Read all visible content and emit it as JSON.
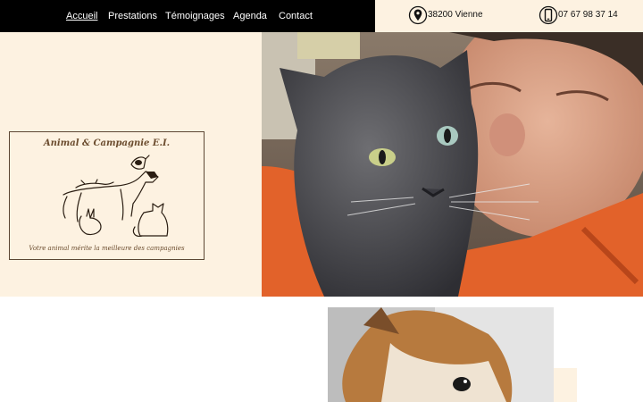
{
  "nav": {
    "items": [
      {
        "label": "Accueil",
        "active": true
      },
      {
        "label": "Prestations"
      },
      {
        "label": "Témoignages"
      },
      {
        "label": "Agenda"
      },
      {
        "label": "Contact"
      }
    ]
  },
  "contact": {
    "location": {
      "icon": "location-pin-icon",
      "text": "38200 Vienne"
    },
    "phone": {
      "icon": "smartphone-icon",
      "text": "07 67 98 37 14"
    }
  },
  "logo": {
    "title": "Animal & Campagnie E.I.",
    "tagline": "Votre animal mérite la meilleure des campagnies"
  },
  "colors": {
    "nav_bg": "#000000",
    "cream": "#fdf2e1",
    "logo_brown": "#6b4c2e"
  }
}
